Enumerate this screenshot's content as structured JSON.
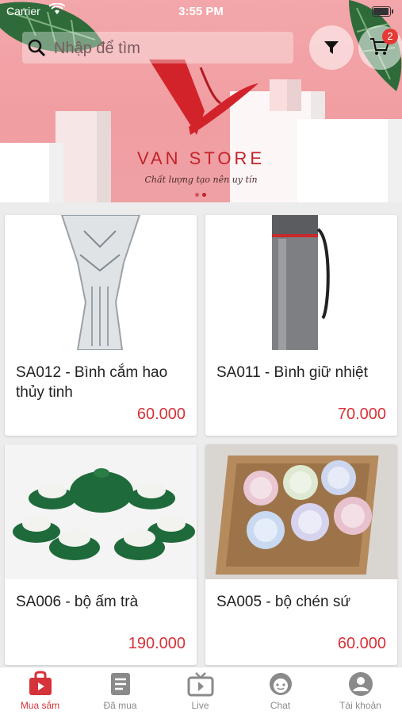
{
  "status_bar": {
    "carrier": "Carrier",
    "time": "3:55 PM"
  },
  "header": {
    "search_placeholder": "Nhập để tìm",
    "cart_count": "2"
  },
  "banner": {
    "brand": "VAN STORE",
    "tagline": "Chất lượng tạo nên uy tín",
    "slides": 2,
    "active_slide": 2
  },
  "products": [
    {
      "name": "SA012 - Bình cắm hao thủy tinh",
      "price": "60.000",
      "image": "glass-vase"
    },
    {
      "name": "SA011 - Bình giữ nhiệt",
      "price": "70.000",
      "image": "thermos-bottle"
    },
    {
      "name": "SA006 - bộ ấm trà",
      "price": "190.000",
      "image": "green-tea-set"
    },
    {
      "name": "SA005 - bộ chén sứ",
      "price": "60.000",
      "image": "porcelain-bowl-set"
    }
  ],
  "tabs": [
    {
      "label": "Mua sắm",
      "icon": "shopping-bag-icon",
      "active": true
    },
    {
      "label": "Đã mua",
      "icon": "document-icon",
      "active": false
    },
    {
      "label": "Live",
      "icon": "tv-play-icon",
      "active": false
    },
    {
      "label": "Chat",
      "icon": "chat-face-icon",
      "active": false
    },
    {
      "label": "Tài khoản",
      "icon": "account-icon",
      "active": false
    }
  ],
  "colors": {
    "accent": "#d63239",
    "banner_pink": "#f1a0a4",
    "badge": "#e53935"
  }
}
